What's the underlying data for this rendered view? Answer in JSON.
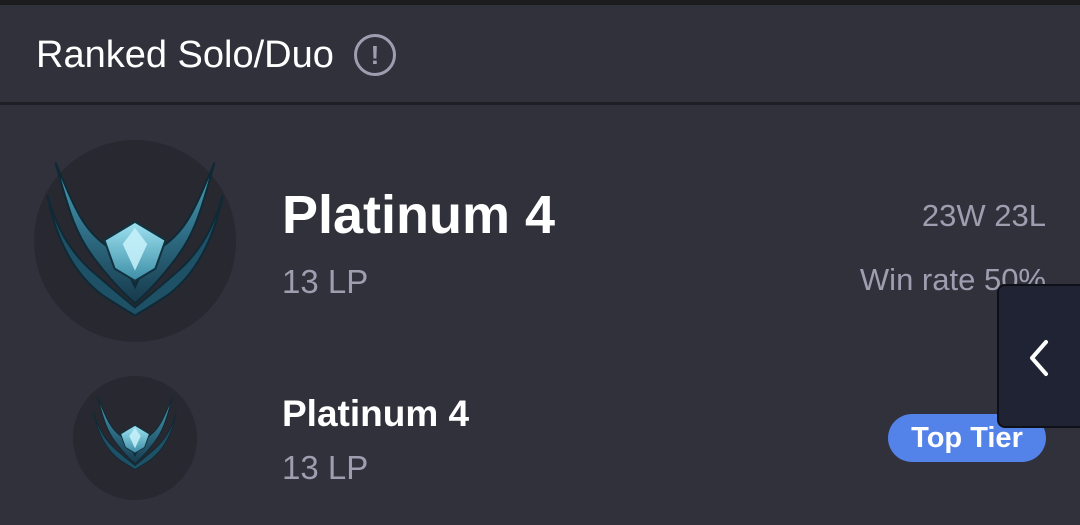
{
  "header": {
    "title": "Ranked Solo/Duo",
    "info_icon": "exclamation-circle-icon"
  },
  "current_rank": {
    "emblem": "platinum-emblem-icon",
    "tier": "Platinum 4",
    "lp": "13 LP",
    "record": "23W 23L",
    "win_rate": "Win rate 50%"
  },
  "top_tier": {
    "emblem": "platinum-emblem-icon",
    "tier": "Platinum 4",
    "lp": "13 LP",
    "badge": "Top Tier"
  },
  "side_tab": {
    "icon": "chevron-left-icon"
  },
  "colors": {
    "background": "#31313c",
    "text_primary": "#ffffff",
    "text_secondary": "#9e9eb1",
    "badge": "#5383e8"
  }
}
